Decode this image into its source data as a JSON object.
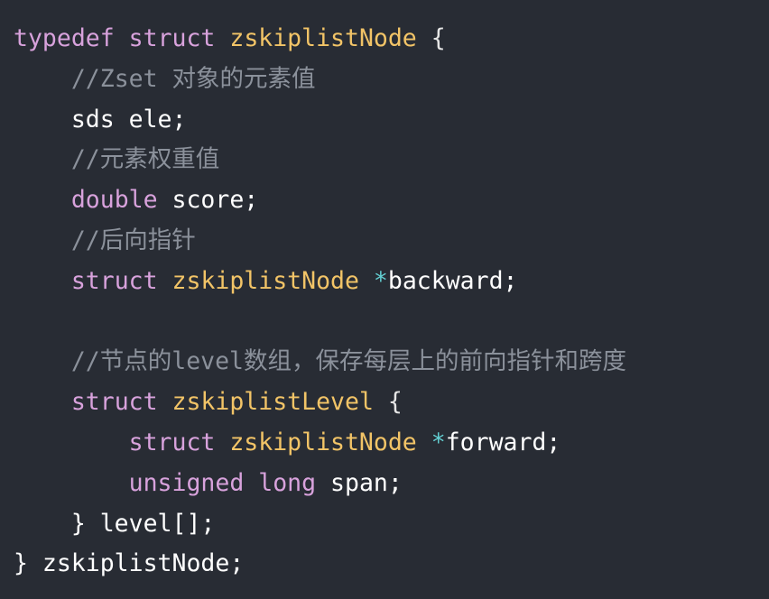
{
  "code": {
    "lines": [
      {
        "tokens": [
          {
            "t": "typedef",
            "k": "kw-struct"
          },
          {
            "t": " ",
            "k": "plain"
          },
          {
            "t": "struct",
            "k": "kw-struct"
          },
          {
            "t": " ",
            "k": "plain"
          },
          {
            "t": "zskiplistNode",
            "k": "type"
          },
          {
            "t": " {",
            "k": "punct"
          }
        ]
      },
      {
        "tokens": [
          {
            "t": "    ",
            "k": "plain"
          },
          {
            "t": "//Zset 对象的元素值",
            "k": "comment"
          }
        ]
      },
      {
        "tokens": [
          {
            "t": "    sds ele;",
            "k": "plain"
          }
        ]
      },
      {
        "tokens": [
          {
            "t": "    ",
            "k": "plain"
          },
          {
            "t": "//元素权重值",
            "k": "comment"
          }
        ]
      },
      {
        "tokens": [
          {
            "t": "    ",
            "k": "plain"
          },
          {
            "t": "double",
            "k": "kw-struct"
          },
          {
            "t": " score;",
            "k": "plain"
          }
        ]
      },
      {
        "tokens": [
          {
            "t": "    ",
            "k": "plain"
          },
          {
            "t": "//后向指针",
            "k": "comment"
          }
        ]
      },
      {
        "tokens": [
          {
            "t": "    ",
            "k": "plain"
          },
          {
            "t": "struct",
            "k": "kw-struct"
          },
          {
            "t": " ",
            "k": "plain"
          },
          {
            "t": "zskiplistNode",
            "k": "type"
          },
          {
            "t": " ",
            "k": "plain"
          },
          {
            "t": "*",
            "k": "ptr"
          },
          {
            "t": "backward;",
            "k": "plain"
          }
        ]
      },
      {
        "tokens": []
      },
      {
        "tokens": [
          {
            "t": "    ",
            "k": "plain"
          },
          {
            "t": "//节点的level数组，保存每层上的前向指针和跨度",
            "k": "comment"
          }
        ]
      },
      {
        "tokens": [
          {
            "t": "    ",
            "k": "plain"
          },
          {
            "t": "struct",
            "k": "kw-struct"
          },
          {
            "t": " ",
            "k": "plain"
          },
          {
            "t": "zskiplistLevel",
            "k": "type"
          },
          {
            "t": " {",
            "k": "punct"
          }
        ]
      },
      {
        "tokens": [
          {
            "t": "        ",
            "k": "plain"
          },
          {
            "t": "struct",
            "k": "kw-struct"
          },
          {
            "t": " ",
            "k": "plain"
          },
          {
            "t": "zskiplistNode",
            "k": "type"
          },
          {
            "t": " ",
            "k": "plain"
          },
          {
            "t": "*",
            "k": "ptr"
          },
          {
            "t": "forward;",
            "k": "plain"
          }
        ]
      },
      {
        "tokens": [
          {
            "t": "        ",
            "k": "plain"
          },
          {
            "t": "unsigned",
            "k": "kw-struct"
          },
          {
            "t": " ",
            "k": "plain"
          },
          {
            "t": "long",
            "k": "kw-struct"
          },
          {
            "t": " span;",
            "k": "plain"
          }
        ]
      },
      {
        "tokens": [
          {
            "t": "    } level[];",
            "k": "plain"
          }
        ]
      },
      {
        "tokens": [
          {
            "t": "} zskiplistNode;",
            "k": "plain"
          }
        ]
      }
    ]
  },
  "colors": {
    "background": "#282c34",
    "keyword": "#d8a2dc",
    "type": "#f2c467",
    "pointer": "#63d0d3",
    "comment": "#8b919b",
    "text": "#ffffff"
  }
}
